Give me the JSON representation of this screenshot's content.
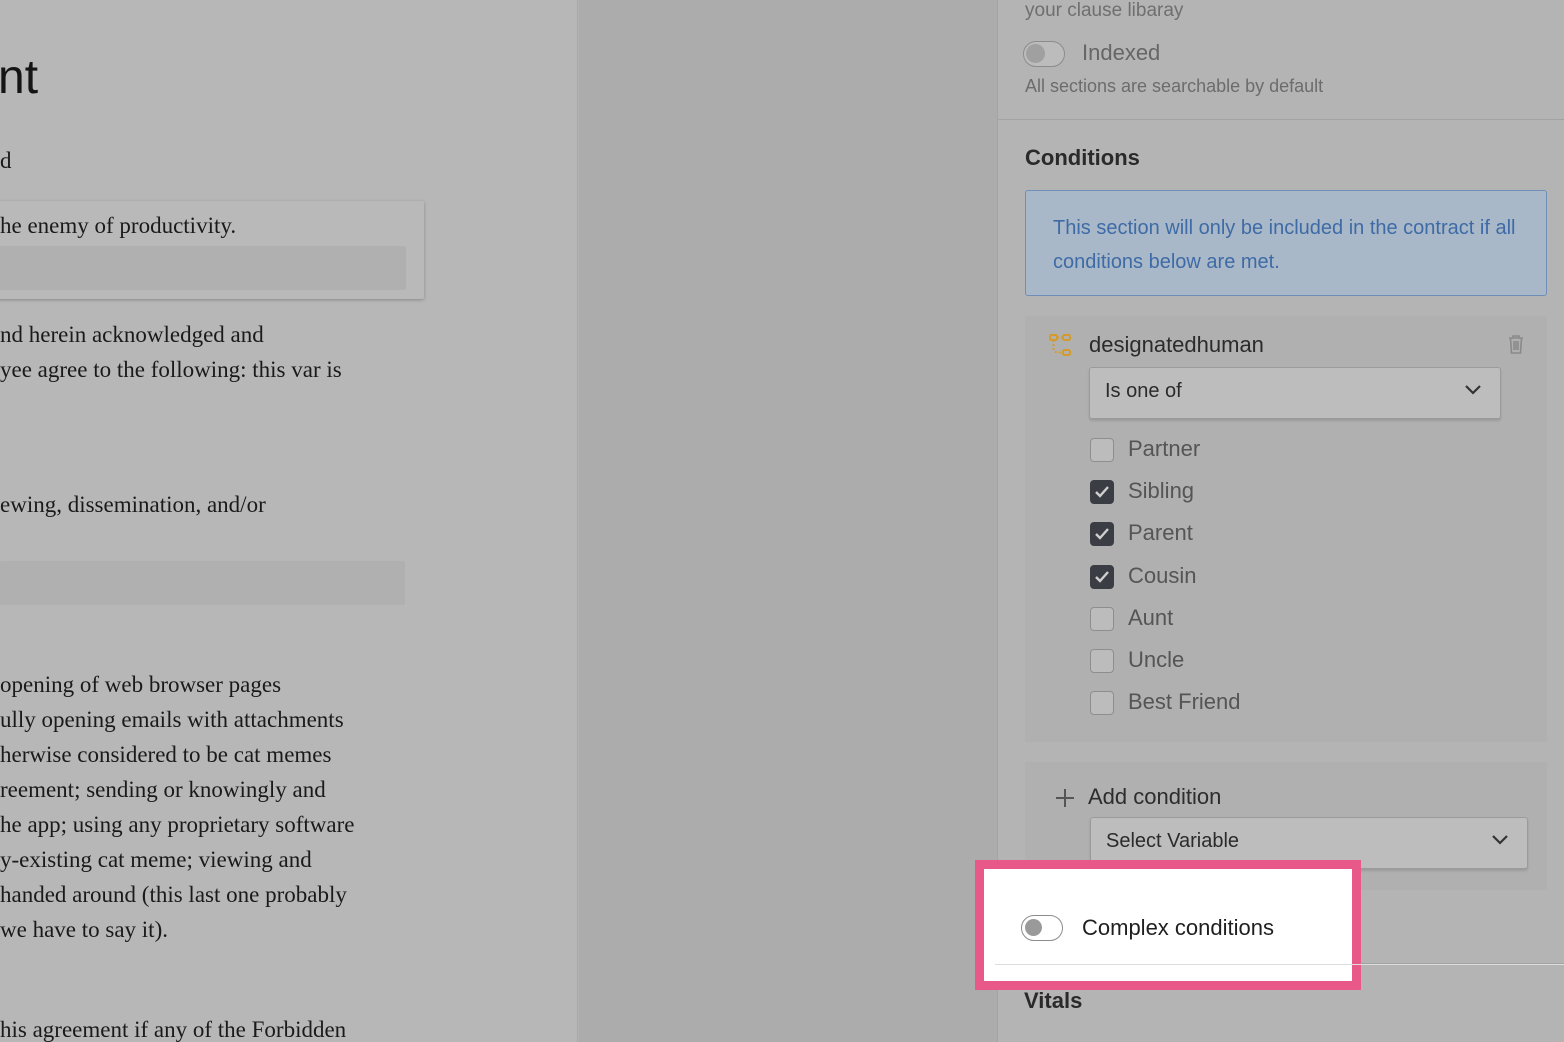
{
  "document": {
    "title": "nt",
    "card_text": "he enemy of productivity.",
    "lines": [
      "d",
      "nd herein acknowledged and",
      "yee agree to the following: this var is",
      "ewing, dissemination, and/or",
      " opening of web browser pages",
      "ully opening emails with attachments",
      "herwise considered to be cat memes",
      "reement; sending or knowingly and",
      "he app; using any proprietary software",
      "y-existing cat meme; viewing and",
      "handed around (this last one probably",
      "we have to say it).",
      "his agreement if any of the Forbidden"
    ]
  },
  "panel": {
    "clause_help": "your clause libaray",
    "indexed_label": "Indexed",
    "indexed_help": "All sections are searchable by default",
    "conditions_heading": "Conditions",
    "info_text": "This section will only be included in the contract if all conditions below are met.",
    "condition": {
      "variable": "designatedhuman",
      "operator": "Is one of",
      "options": [
        {
          "label": "Partner",
          "checked": false
        },
        {
          "label": "Sibling",
          "checked": true
        },
        {
          "label": "Parent",
          "checked": true
        },
        {
          "label": "Cousin",
          "checked": true
        },
        {
          "label": "Aunt",
          "checked": false
        },
        {
          "label": "Uncle",
          "checked": false
        },
        {
          "label": "Best Friend",
          "checked": false
        }
      ]
    },
    "add_condition_label": "Add condition",
    "select_variable": "Select Variable",
    "complex_conditions_label": "Complex conditions",
    "vitals_heading": "Vitals"
  },
  "colors": {
    "highlight": "#e8598a",
    "info_text": "#3e6ba6",
    "checked": "#3a3d44",
    "variable_icon": "#d49a2a"
  }
}
